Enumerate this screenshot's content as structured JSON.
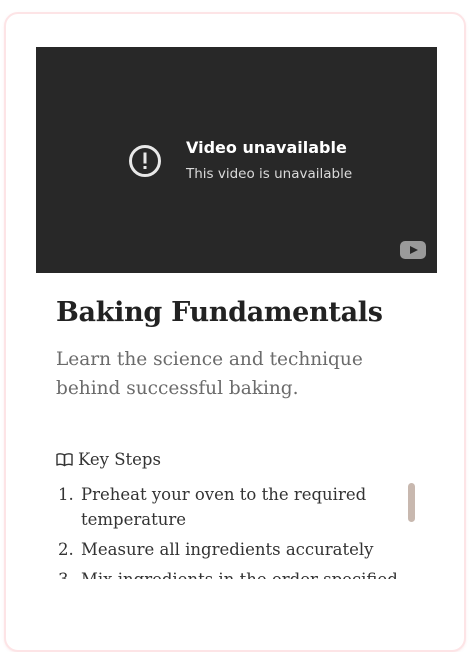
{
  "video": {
    "title": "Video unavailable",
    "subtitle": "This video is unavailable",
    "alert_icon": "alert-circle-icon",
    "brand_icon": "youtube-icon"
  },
  "lesson": {
    "title": "Baking Fundamentals",
    "description": "Learn the science and technique behind successful baking."
  },
  "steps": {
    "heading": "Key Steps",
    "heading_icon": "book-open-icon",
    "items": [
      {
        "number": "1.",
        "text": "Preheat your oven to the required temperature"
      },
      {
        "number": "2.",
        "text": "Measure all ingredients accurately"
      },
      {
        "number": "3.",
        "text": "Mix ingredients in the order specified"
      }
    ]
  },
  "colors": {
    "card_border": "#fde4e6",
    "video_bg": "#282828",
    "scrollbar_thumb": "#c8b8af",
    "title_text": "#222222",
    "description_text": "#6b6b6b"
  }
}
